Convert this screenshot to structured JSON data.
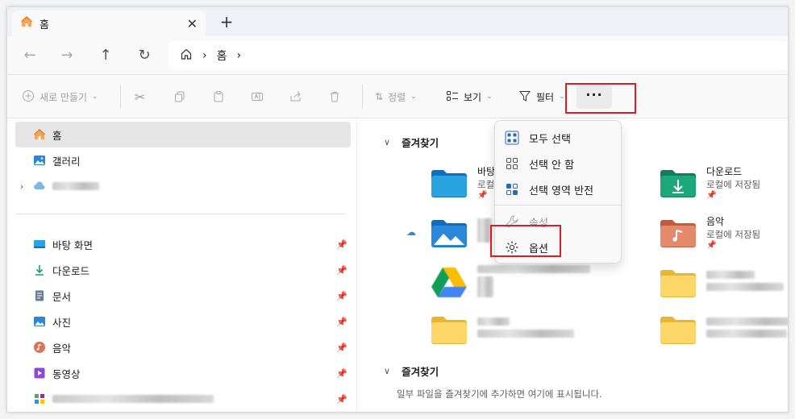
{
  "tab": {
    "title": "홈",
    "close": "✕",
    "new": "+"
  },
  "address": {
    "crumb": "홈"
  },
  "commands": {
    "new": "새로 만들기",
    "sort": "정렬",
    "view": "보기",
    "filter": "필터",
    "more": "···"
  },
  "sidebar": {
    "items": [
      {
        "label": "홈"
      },
      {
        "label": "갤러리"
      },
      {
        "label": "바탕 화면"
      },
      {
        "label": "다운로드"
      },
      {
        "label": "문서"
      },
      {
        "label": "사진"
      },
      {
        "label": "음악"
      },
      {
        "label": "동영상"
      }
    ]
  },
  "main": {
    "section1": "즐겨찾기",
    "section2": "즐겨찾기",
    "hint": "일부 파일을 즐겨찾기에 추가하면 여기에 표시됩니다.",
    "tiles": {
      "desktop_name": "바탕",
      "desktop_sub": "로컬",
      "downloads_name": "다운로드",
      "downloads_sub": "로컬에 저장됨",
      "music_name": "음악",
      "music_sub": "로컬에 저장됨"
    }
  },
  "menu": {
    "select_all": "모두 선택",
    "select_none": "선택 안 함",
    "invert": "선택 영역 반전",
    "properties": "속성",
    "options": "옵션"
  },
  "colors": {
    "highlight": "#e01b24",
    "accent": "#0078d4"
  }
}
